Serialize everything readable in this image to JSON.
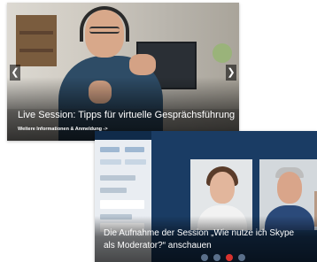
{
  "cards": [
    {
      "title": "Live Session: Tipps für virtuelle Gesprächsführung",
      "link_text": "Weitere Informationen & Anmeldung ->",
      "prev_icon": "chevron-left-icon",
      "next_icon": "chevron-right-icon"
    },
    {
      "title_line1": "Die Aufnahme der Session „Wie nutze ich Skype",
      "title_line2": "als Moderator?“ anschauen"
    }
  ],
  "colors": {
    "overlay_text": "#ffffff",
    "meeting_background": "#1a3c64",
    "end_call": "#d8322e",
    "sidebar": "#e9edf2"
  }
}
